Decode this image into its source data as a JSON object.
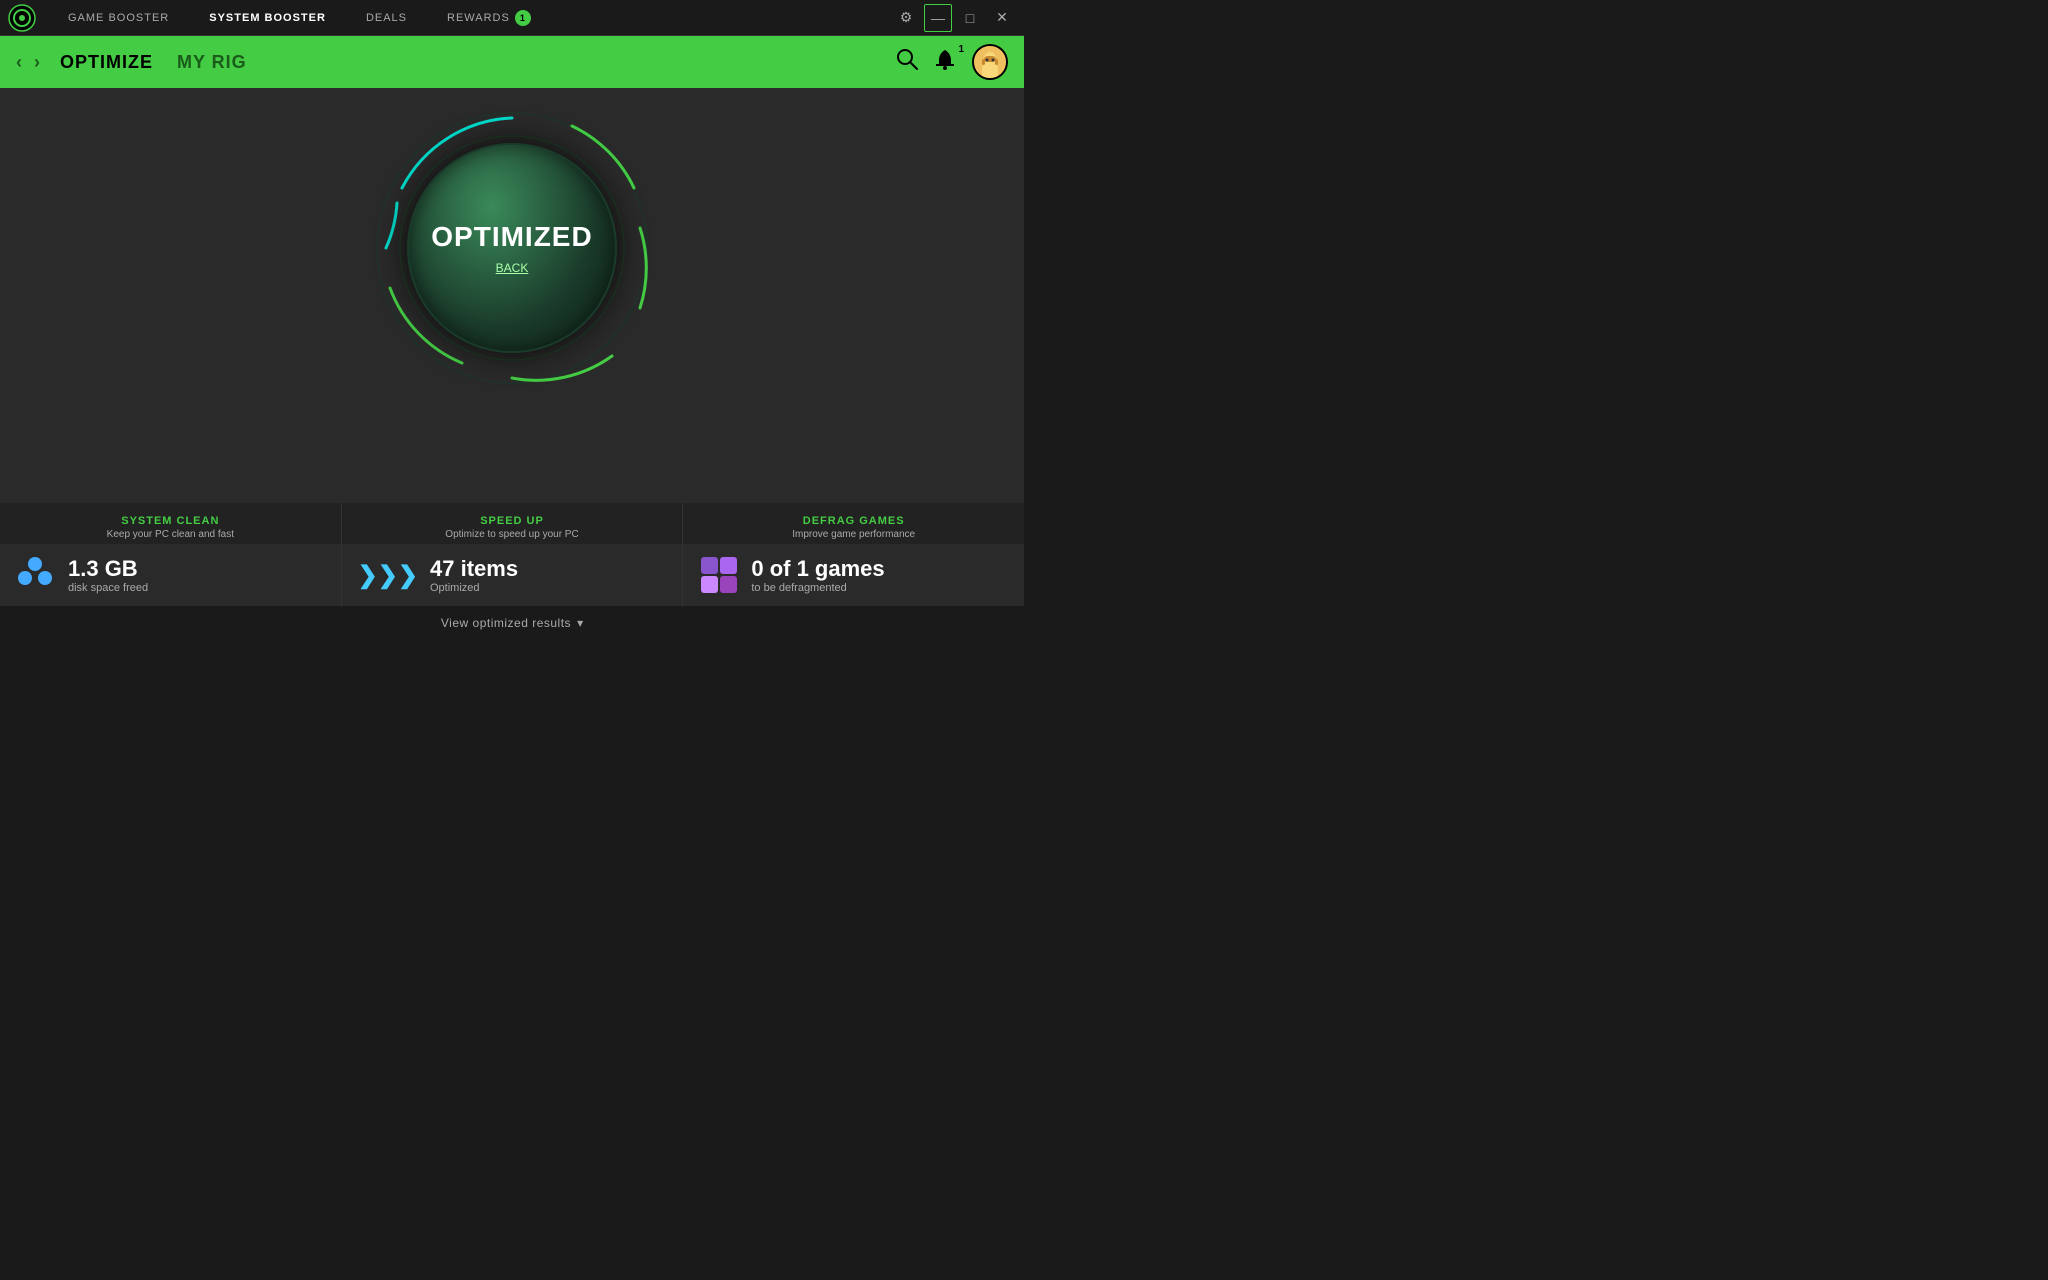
{
  "titleBar": {
    "logo": "razer-logo",
    "navItems": [
      {
        "label": "GAME BOOSTER",
        "active": false
      },
      {
        "label": "SYSTEM BOOSTER",
        "active": true
      },
      {
        "label": "DEALS",
        "active": false
      },
      {
        "label": "REWARDS",
        "active": false,
        "badge": "1"
      }
    ],
    "controls": {
      "settings": "⚙",
      "minimize": "—",
      "maximize": "□",
      "close": "✕"
    },
    "notification_count": "1"
  },
  "secondaryBar": {
    "back": "‹",
    "forward": "›",
    "navItems": [
      {
        "label": "OPTIMIZE",
        "active": true
      },
      {
        "label": "MY RIG",
        "active": false
      }
    ]
  },
  "mainContent": {
    "status_label": "OPTIMIZED",
    "back_label": "BACK"
  },
  "cards": [
    {
      "title": "SYSTEM CLEAN",
      "subtitle": "Keep your PC clean and fast",
      "value": "1.3 GB",
      "value_detail": "disk space freed",
      "icon_type": "circles"
    },
    {
      "title": "SPEED UP",
      "subtitle": "Optimize to speed up your PC",
      "value": "47 items",
      "value_detail": "Optimized",
      "icon_type": "arrows"
    },
    {
      "title": "DEFRAG GAMES",
      "subtitle": "Improve game performance",
      "value": "0 of 1 games",
      "value_detail": "to be defragmented",
      "icon_type": "diamond"
    }
  ],
  "viewResults": {
    "label": "View optimized results",
    "icon": "▾"
  },
  "colors": {
    "accent": "#44cc44",
    "bg_dark": "#1a1a1a",
    "bg_medium": "#2a2a2a"
  }
}
